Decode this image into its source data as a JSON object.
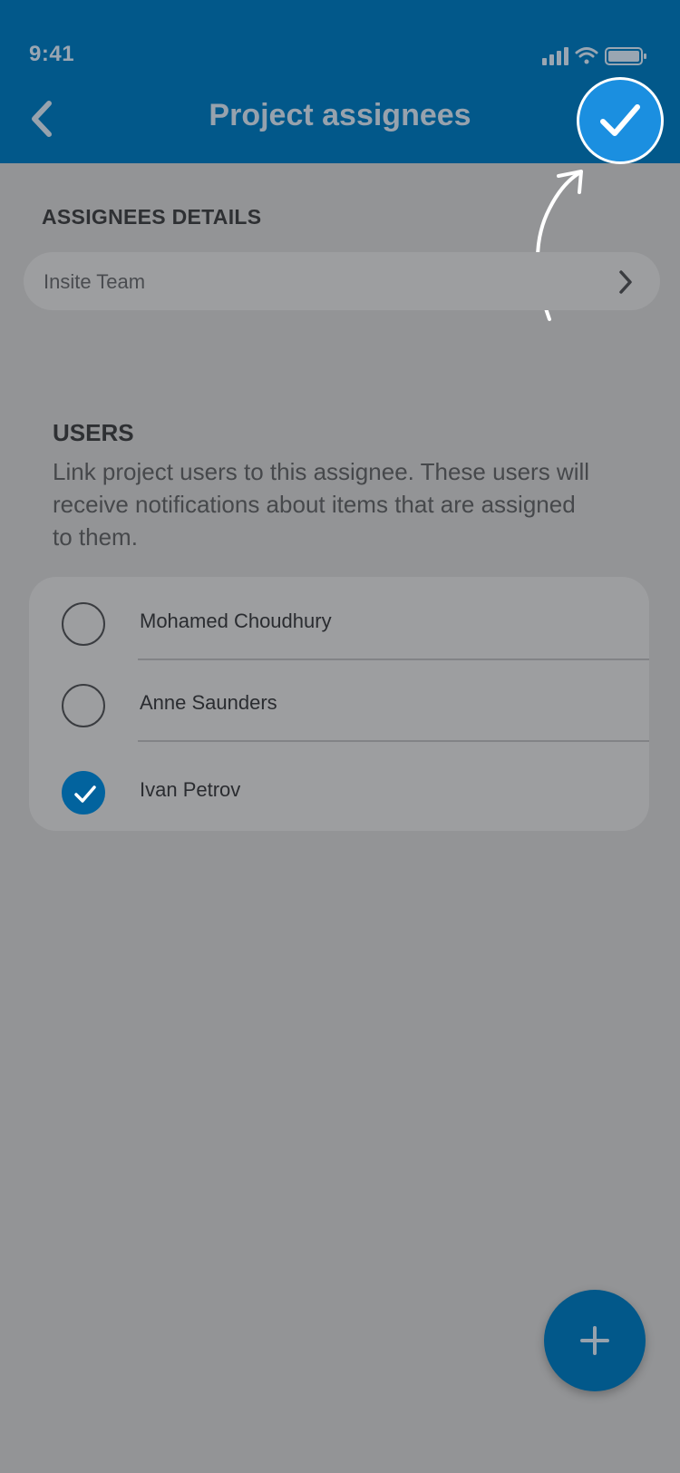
{
  "status_bar": {
    "time": "9:41"
  },
  "header": {
    "title": "Project assignees"
  },
  "assignees_details": {
    "heading": "ASSIGNEES DETAILS",
    "team_label": "Insite Team"
  },
  "users": {
    "heading": "USERS",
    "description": "Link project users to this assignee. These users will receive notifications about items that are assigned to them.",
    "list": [
      {
        "name": "Mohamed Choudhury",
        "selected": false
      },
      {
        "name": "Anne Saunders",
        "selected": false
      },
      {
        "name": "Ivan Petrov",
        "selected": true
      }
    ]
  },
  "colors": {
    "header_bg": "#02588a",
    "accent": "#1b8fe0",
    "overlay_bg": "#939496"
  }
}
